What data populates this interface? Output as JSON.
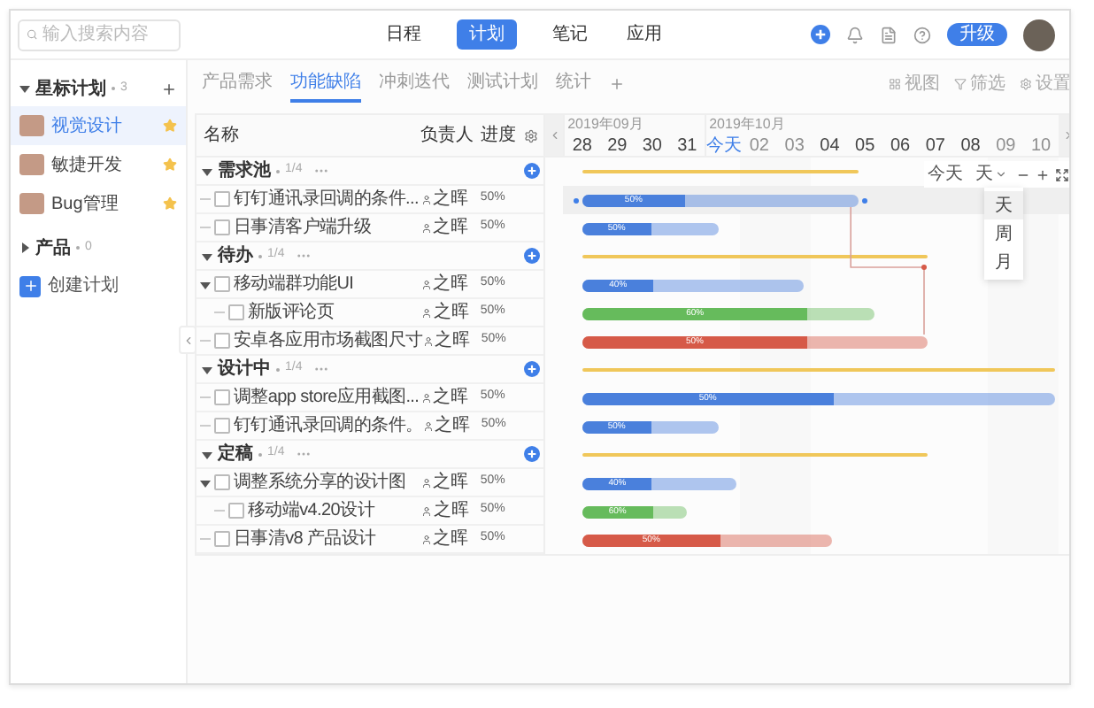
{
  "search": {
    "placeholder": "输入搜索内容"
  },
  "nav": [
    {
      "label": "日程",
      "selected": false
    },
    {
      "label": "计划",
      "selected": true
    },
    {
      "label": "笔记",
      "selected": false
    },
    {
      "label": "应用",
      "selected": false
    }
  ],
  "upgrade_button": "升级",
  "sidebar": {
    "sections": [
      {
        "title": "星标计划",
        "count": "3",
        "expanded": true,
        "items": [
          {
            "label": "视觉设计",
            "selected": true,
            "starred": true
          },
          {
            "label": "敏捷开发",
            "selected": false,
            "starred": true
          },
          {
            "label": "Bug管理",
            "selected": false,
            "starred": true
          }
        ]
      },
      {
        "title": "产品",
        "count": "0",
        "expanded": false
      }
    ],
    "create_button": "创建计划"
  },
  "tabs": [
    {
      "label": "产品需求",
      "selected": false
    },
    {
      "label": "功能缺陷",
      "selected": true
    },
    {
      "label": "冲刺迭代",
      "selected": false
    },
    {
      "label": "测试计划",
      "selected": false
    },
    {
      "label": "统计",
      "selected": false
    }
  ],
  "toolbar": [
    {
      "label": "视图",
      "kind": "view"
    },
    {
      "label": "筛选",
      "kind": "filter"
    },
    {
      "label": "设置",
      "kind": "settings"
    }
  ],
  "table": {
    "columns": [
      "名称",
      "负责人",
      "进度"
    ],
    "groups": [
      {
        "name": "需求池",
        "count": "1/4",
        "tasks": [
          {
            "name": "钉钉通讯录回调的条件...",
            "owner": "之晖",
            "progress": "50%",
            "checked": false,
            "selected": true,
            "bar": {
              "color": "#4a80dc",
              "level": 0.37,
              "label": "50%"
            }
          },
          {
            "name": "日事清客户端升级",
            "owner": "之晖",
            "progress": "50%",
            "checked": false,
            "selected": false,
            "bar": {
              "color": "#4a80dc",
              "level": 0.5,
              "label": "50%"
            }
          }
        ]
      },
      {
        "name": "待办",
        "count": "1/4",
        "tasks": [
          {
            "name": "移动端群功能UI",
            "owner": "之晖",
            "progress": "50%",
            "checked": false,
            "selected": false,
            "expanded": true,
            "bar": {
              "color": "#4a80dc",
              "level": 0.32,
              "label": "40%"
            },
            "children": [
              {
                "name": "新版评论页",
                "owner": "之晖",
                "progress": "50%",
                "checked": false,
                "selected": false,
                "bar": {
                  "color": "#66bb5c",
                  "level": 0.77,
                  "label": "60%"
                }
              }
            ]
          },
          {
            "name": "安卓各应用市场截图尺寸",
            "owner": "之晖",
            "progress": "50%",
            "checked": false,
            "selected": false,
            "bar": {
              "color": "#d65a48",
              "level": 0.65,
              "label": "50%"
            }
          }
        ]
      },
      {
        "name": "设计中",
        "count": "1/4",
        "tasks": [
          {
            "name": "调整app store应用截图...",
            "owner": "之晖",
            "progress": "50%",
            "checked": false,
            "selected": false,
            "bar": {
              "color": "#4a80dc",
              "level": 0.53,
              "label": "50%"
            }
          },
          {
            "name": "钉钉通讯录回调的条件。",
            "owner": "之晖",
            "progress": "50%",
            "checked": false,
            "selected": false,
            "bar": {
              "color": "#4a80dc",
              "level": 0.5,
              "label": "50%"
            }
          }
        ]
      },
      {
        "name": "定稿",
        "count": "1/4",
        "tasks": [
          {
            "name": "调整系统分享的设计图",
            "owner": "之晖",
            "progress": "50%",
            "checked": false,
            "selected": false,
            "expanded": true,
            "bar": {
              "color": "#4a80dc",
              "level": 0.45,
              "label": "40%"
            },
            "children": [
              {
                "name": "移动端v4.20设计",
                "owner": "之晖",
                "progress": "50%",
                "checked": false,
                "selected": false,
                "bar": {
                  "color": "#66bb5c",
                  "level": 0.67,
                  "label": "60%"
                }
              }
            ]
          },
          {
            "name": "日事清v8 产品设计",
            "owner": "之晖",
            "progress": "50%",
            "checked": false,
            "selected": false,
            "bar": {
              "color": "#d65a48",
              "level": 0.55,
              "label": "50%"
            }
          }
        ]
      }
    ]
  },
  "gantt": {
    "months": [
      {
        "label": "2019年09月",
        "days": [
          {
            "label": "28",
            "today": false,
            "weekend": false
          },
          {
            "label": "29",
            "today": false,
            "weekend": false
          },
          {
            "label": "30",
            "today": false,
            "weekend": false
          },
          {
            "label": "31",
            "today": false,
            "weekend": false
          }
        ]
      },
      {
        "label": "2019年10月",
        "days": [
          {
            "label": "今天",
            "today": true,
            "weekend": false
          },
          {
            "label": "02",
            "today": false,
            "weekend": true
          },
          {
            "label": "03",
            "today": false,
            "weekend": true
          },
          {
            "label": "04",
            "today": false,
            "weekend": false
          },
          {
            "label": "05",
            "today": false,
            "weekend": false
          },
          {
            "label": "06",
            "today": false,
            "weekend": false
          },
          {
            "label": "07",
            "today": false,
            "weekend": false
          },
          {
            "label": "08",
            "today": false,
            "weekend": false
          },
          {
            "label": "09",
            "today": false,
            "weekend": true
          },
          {
            "label": "10",
            "today": false,
            "weekend": true
          }
        ]
      }
    ],
    "today_button": "今天",
    "scale": {
      "value": "天",
      "options": [
        {
          "label": "天",
          "selected": true
        },
        {
          "label": "周",
          "selected": false
        },
        {
          "label": "月",
          "selected": false
        }
      ]
    }
  }
}
